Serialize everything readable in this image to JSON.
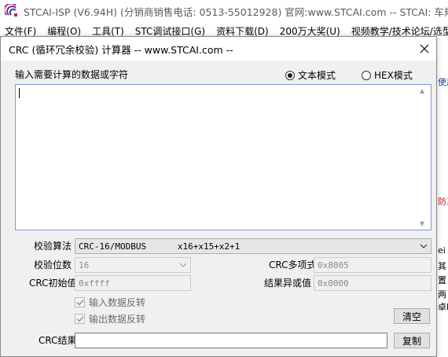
{
  "main_window": {
    "title": "STCAI-ISP (V6.94H) (分销商销售电话: 0513-55012928) 官网:www.STCAI.com  -- STCAI: 车规AEC-",
    "menu": [
      "文件(F)",
      "编程(O)",
      "工具(T)",
      "STC调试接口(G)",
      "资料下载(D)",
      "200万大奖(U)",
      "视频教学/技术论坛/选型(",
      ""
    ],
    "right_strip": [
      "使用",
      "防真",
      "ei",
      "其",
      "置",
      "两",
      "卓P"
    ]
  },
  "dialog": {
    "title": "CRC (循环冗余校验) 计算器 -- www.STCAI.com --",
    "input_label": "输入需要计算的数据或字符",
    "input_value": "",
    "mode_text": "文本模式",
    "mode_hex": "HEX模式",
    "mode_selected": "text",
    "algo_label": "校验算法",
    "algo_value": "CRC-16/MODBUS      x16+x15+x2+1",
    "bits_label": "校验位数",
    "bits_value": "16",
    "poly_label": "CRC多项式",
    "poly_value": "0x8005",
    "init_label": "CRC初始值",
    "init_value": "0xffff",
    "xor_label": "结果异或值",
    "xor_value": "0x0000",
    "reflect_in_label": "输入数据反转",
    "reflect_in_checked": true,
    "reflect_out_label": "输出数据反转",
    "reflect_out_checked": true,
    "clear_label": "清空",
    "result_label": "CRC结果",
    "result_value": "",
    "copy_label": "复制"
  },
  "colors": {
    "dialog_bg": "#f0f0f0",
    "textarea_border": "#7a9cd3",
    "disabled_text": "#8a8a8a"
  }
}
